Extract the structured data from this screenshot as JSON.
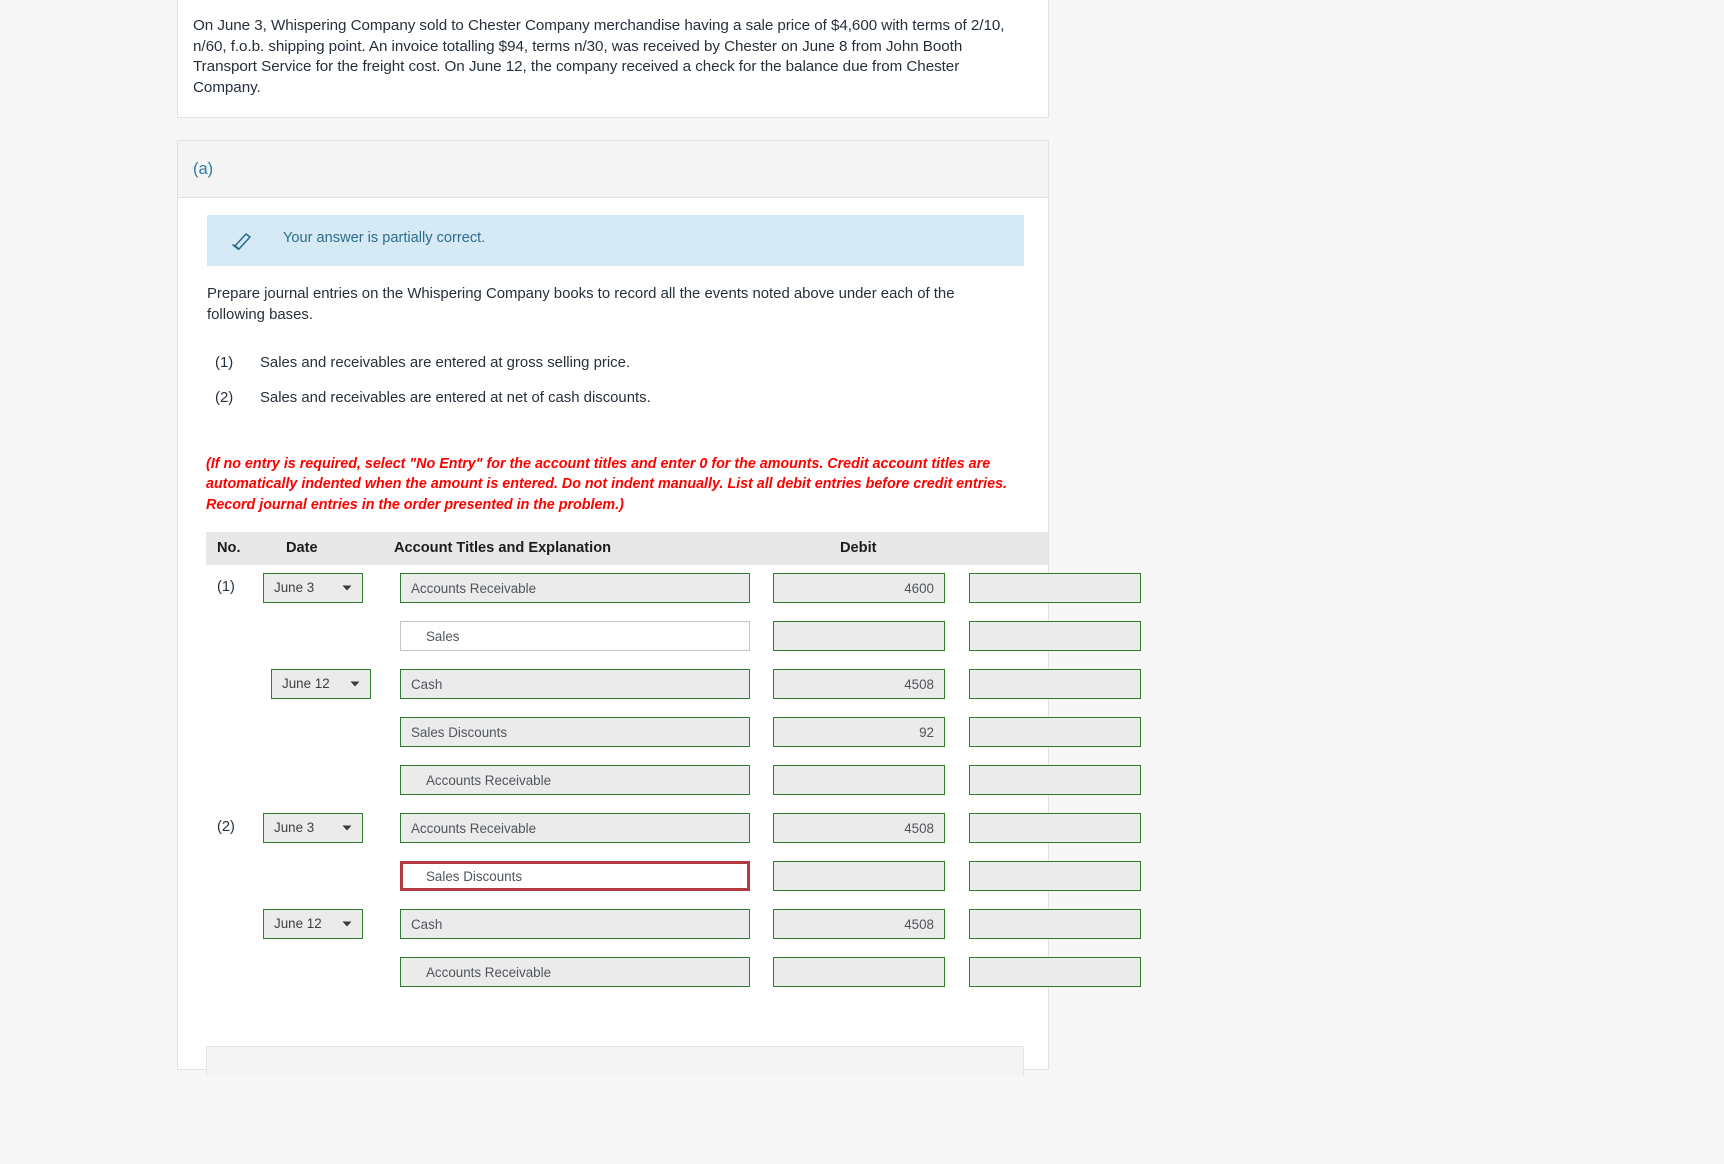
{
  "problem": {
    "text": "On June 3, Whispering Company sold to Chester Company merchandise having a sale price of $4,600 with terms of 2/10, n/60, f.o.b. shipping point. An invoice totalling $94, terms n/30, was received by Chester on June 8 from John Booth Transport Service for the freight cost. On June 12, the company received a check for the balance due from Chester Company."
  },
  "part": {
    "label": "(a)",
    "alert": {
      "icon": "eraser-icon",
      "text": "Your answer is partially correct."
    },
    "prompt": "Prepare journal entries on the Whispering Company books to record all the events noted above under each of the following bases.",
    "sub_items": [
      {
        "num": "(1)",
        "text": "Sales and receivables are entered at gross selling price."
      },
      {
        "num": "(2)",
        "text": "Sales and receivables are entered at net of cash discounts."
      }
    ],
    "red_note": "(If no entry is required, select \"No Entry\" for the account titles and enter 0 for the amounts. Credit account titles are automatically indented when the amount is entered. Do not indent manually. List all debit entries before credit entries. Record journal entries in the order presented in the problem.)"
  },
  "journal": {
    "columns": {
      "no": "No.",
      "date": "Date",
      "account": "Account Titles and Explanation",
      "debit": "Debit"
    },
    "rows": [
      {
        "no": "(1)",
        "date": "June 3",
        "date_pos": "a",
        "account": "Accounts Receivable",
        "indent": false,
        "style": "normal",
        "debit": "4600",
        "credit": ""
      },
      {
        "no": "",
        "date": "",
        "date_pos": "",
        "account": "Sales",
        "indent": true,
        "style": "plain",
        "debit": "",
        "credit": ""
      },
      {
        "no": "",
        "date": "June 12",
        "date_pos": "b",
        "account": "Cash",
        "indent": false,
        "style": "normal",
        "debit": "4508",
        "credit": ""
      },
      {
        "no": "",
        "date": "",
        "date_pos": "",
        "account": "Sales Discounts",
        "indent": false,
        "style": "normal",
        "debit": "92",
        "credit": ""
      },
      {
        "no": "",
        "date": "",
        "date_pos": "",
        "account": "Accounts Receivable",
        "indent": true,
        "style": "normal",
        "debit": "",
        "credit": ""
      },
      {
        "no": "(2)",
        "date": "June 3",
        "date_pos": "a",
        "account": "Accounts Receivable",
        "indent": false,
        "style": "normal",
        "debit": "4508",
        "credit": ""
      },
      {
        "no": "",
        "date": "",
        "date_pos": "",
        "account": "Sales Discounts",
        "indent": true,
        "style": "error",
        "debit": "",
        "credit": ""
      },
      {
        "no": "",
        "date": "June 12",
        "date_pos": "a",
        "account": "Cash",
        "indent": false,
        "style": "normal",
        "debit": "4508",
        "credit": ""
      },
      {
        "no": "",
        "date": "",
        "date_pos": "",
        "account": "Accounts Receivable",
        "indent": true,
        "style": "normal",
        "debit": "",
        "credit": ""
      }
    ]
  },
  "colors": {
    "accent_blue": "#2e7ba6",
    "alert_bg": "#d5eaf4",
    "alert_text": "#2f6d8c",
    "input_border_green": "#2f7d33",
    "input_border_error": "#b03a3f",
    "note_red": "#ff0000",
    "input_fill": "#ebebeb"
  }
}
